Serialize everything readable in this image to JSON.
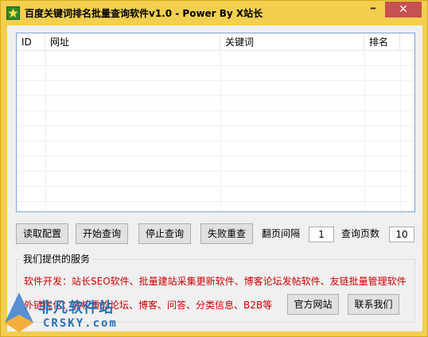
{
  "window": {
    "title": "百度关键词排名批量查询软件v1.0 - Power By X站长",
    "minimize_glyph": "–",
    "close_glyph": "✕",
    "app_icon": "star-icon"
  },
  "table": {
    "columns": [
      "ID",
      "网址",
      "关键词",
      "排名"
    ],
    "rows": []
  },
  "toolbar": {
    "load_config_label": "读取配置",
    "start_query_label": "开始查询",
    "stop_query_label": "停止查询",
    "retry_failed_label": "失败重查",
    "page_interval_label": "翻页间隔",
    "page_interval_value": "1",
    "query_pages_label": "查询页数",
    "query_pages_value": "10"
  },
  "services": {
    "group_title": "我们提供的服务",
    "line1": "软件开发：站长SEO软件、批量建站采集更新软件、博客论坛发帖软件、友链批量管理软件",
    "line2": "外链优化：高权重的论坛、博客、问答、分类信息、B2B等",
    "official_site_label": "官方网站",
    "contact_us_label": "联系我们"
  },
  "watermark": {
    "logo": "crsky-logo-icon",
    "text_cn": "非凡软件站",
    "text_en": "CRSKY.com"
  },
  "colors": {
    "titlebar": "#f2cf4f",
    "close_button": "#c75050",
    "service_text": "#cc0000",
    "watermark": "#2b6fb5"
  }
}
